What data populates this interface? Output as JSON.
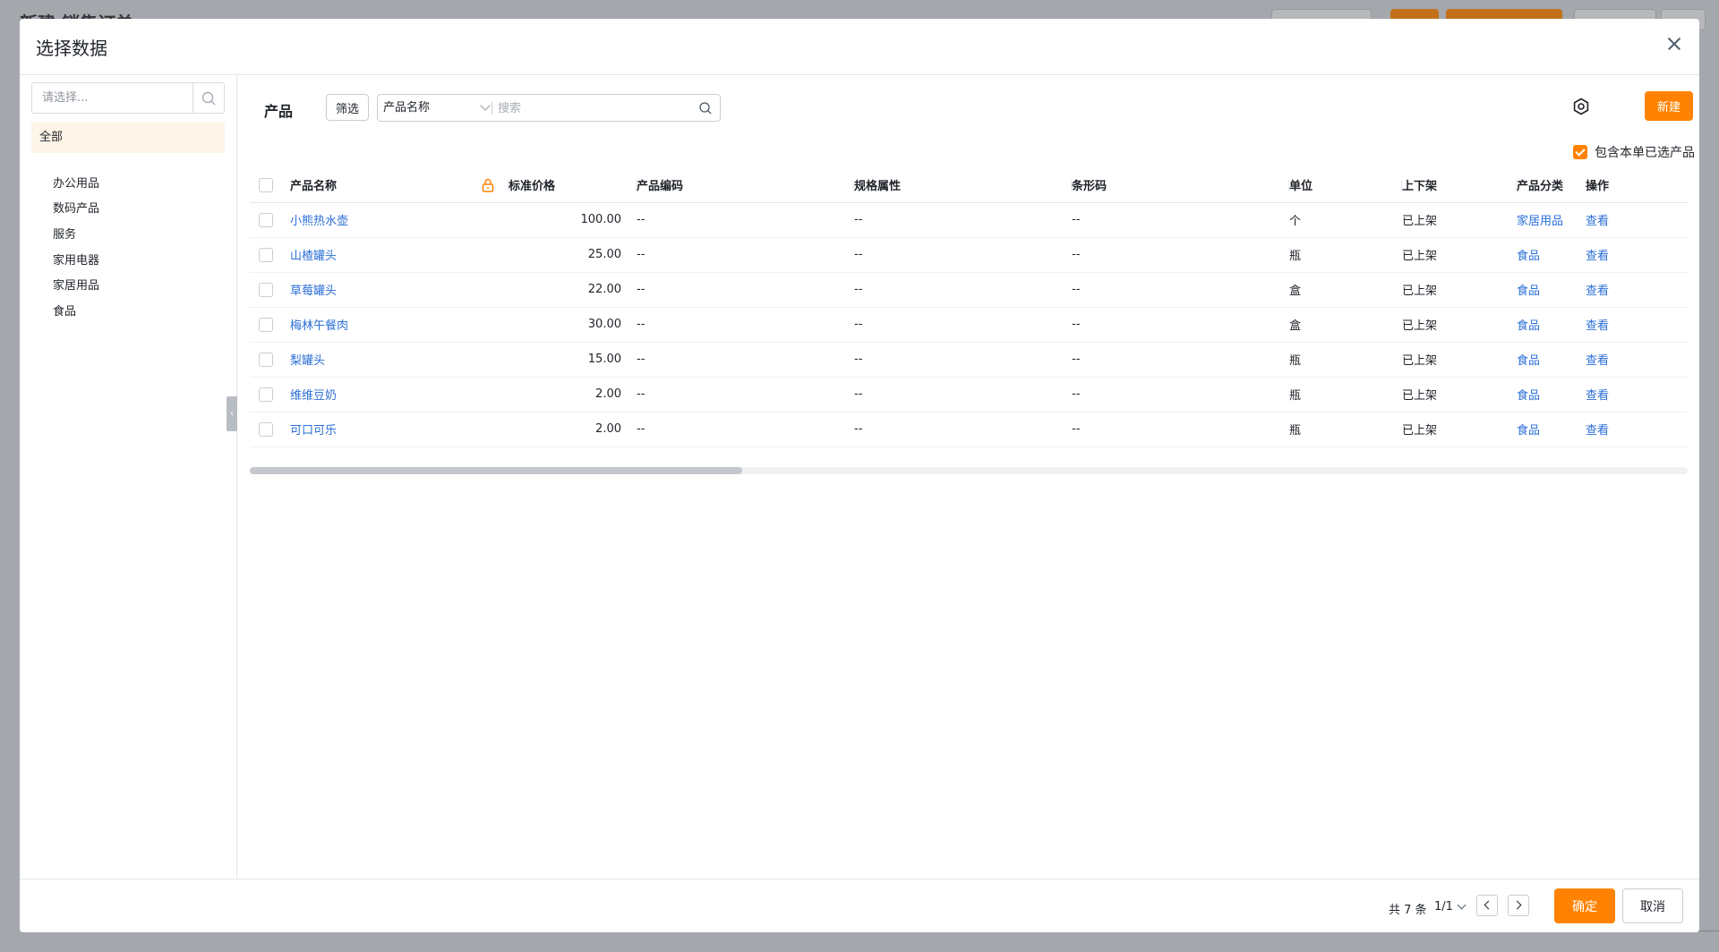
{
  "background": {
    "page_title": "新建 销售订单"
  },
  "modal": {
    "title": "选择数据"
  },
  "sidebar": {
    "search_placeholder": "请选择...",
    "all_label": "全部",
    "categories": [
      "办公用品",
      "数码产品",
      "服务",
      "家用电器",
      "家居用品",
      "食品"
    ]
  },
  "toolbar": {
    "title": "产品",
    "filter_label": "筛选",
    "search_field": "产品名称",
    "search_placeholder": "搜索",
    "new_label": "新建",
    "include_selected_label": "包含本单已选产品",
    "include_selected_checked": true
  },
  "table": {
    "columns": [
      "产品名称",
      "标准价格",
      "产品编码",
      "规格属性",
      "条形码",
      "单位",
      "上下架",
      "产品分类",
      "操作"
    ],
    "rows": [
      {
        "name": "小熊热水壶",
        "price": "100.00",
        "code": "--",
        "spec": "--",
        "barcode": "--",
        "unit": "个",
        "status": "已上架",
        "category": "家居用品",
        "action": "查看"
      },
      {
        "name": "山楂罐头",
        "price": "25.00",
        "code": "--",
        "spec": "--",
        "barcode": "--",
        "unit": "瓶",
        "status": "已上架",
        "category": "食品",
        "action": "查看"
      },
      {
        "name": "草莓罐头",
        "price": "22.00",
        "code": "--",
        "spec": "--",
        "barcode": "--",
        "unit": "盒",
        "status": "已上架",
        "category": "食品",
        "action": "查看"
      },
      {
        "name": "梅林午餐肉",
        "price": "30.00",
        "code": "--",
        "spec": "--",
        "barcode": "--",
        "unit": "盒",
        "status": "已上架",
        "category": "食品",
        "action": "查看"
      },
      {
        "name": "梨罐头",
        "price": "15.00",
        "code": "--",
        "spec": "--",
        "barcode": "--",
        "unit": "瓶",
        "status": "已上架",
        "category": "食品",
        "action": "查看"
      },
      {
        "name": "维维豆奶",
        "price": "2.00",
        "code": "--",
        "spec": "--",
        "barcode": "--",
        "unit": "瓶",
        "status": "已上架",
        "category": "食品",
        "action": "查看"
      },
      {
        "name": "可口可乐",
        "price": "2.00",
        "code": "--",
        "spec": "--",
        "barcode": "--",
        "unit": "瓶",
        "status": "已上架",
        "category": "食品",
        "action": "查看"
      }
    ]
  },
  "footer": {
    "total_label": "共 7 条",
    "page_indicator": "1/1",
    "confirm_label": "确定",
    "cancel_label": "取消"
  },
  "colors": {
    "accent": "#ff8300",
    "link": "#2b6fd6"
  }
}
